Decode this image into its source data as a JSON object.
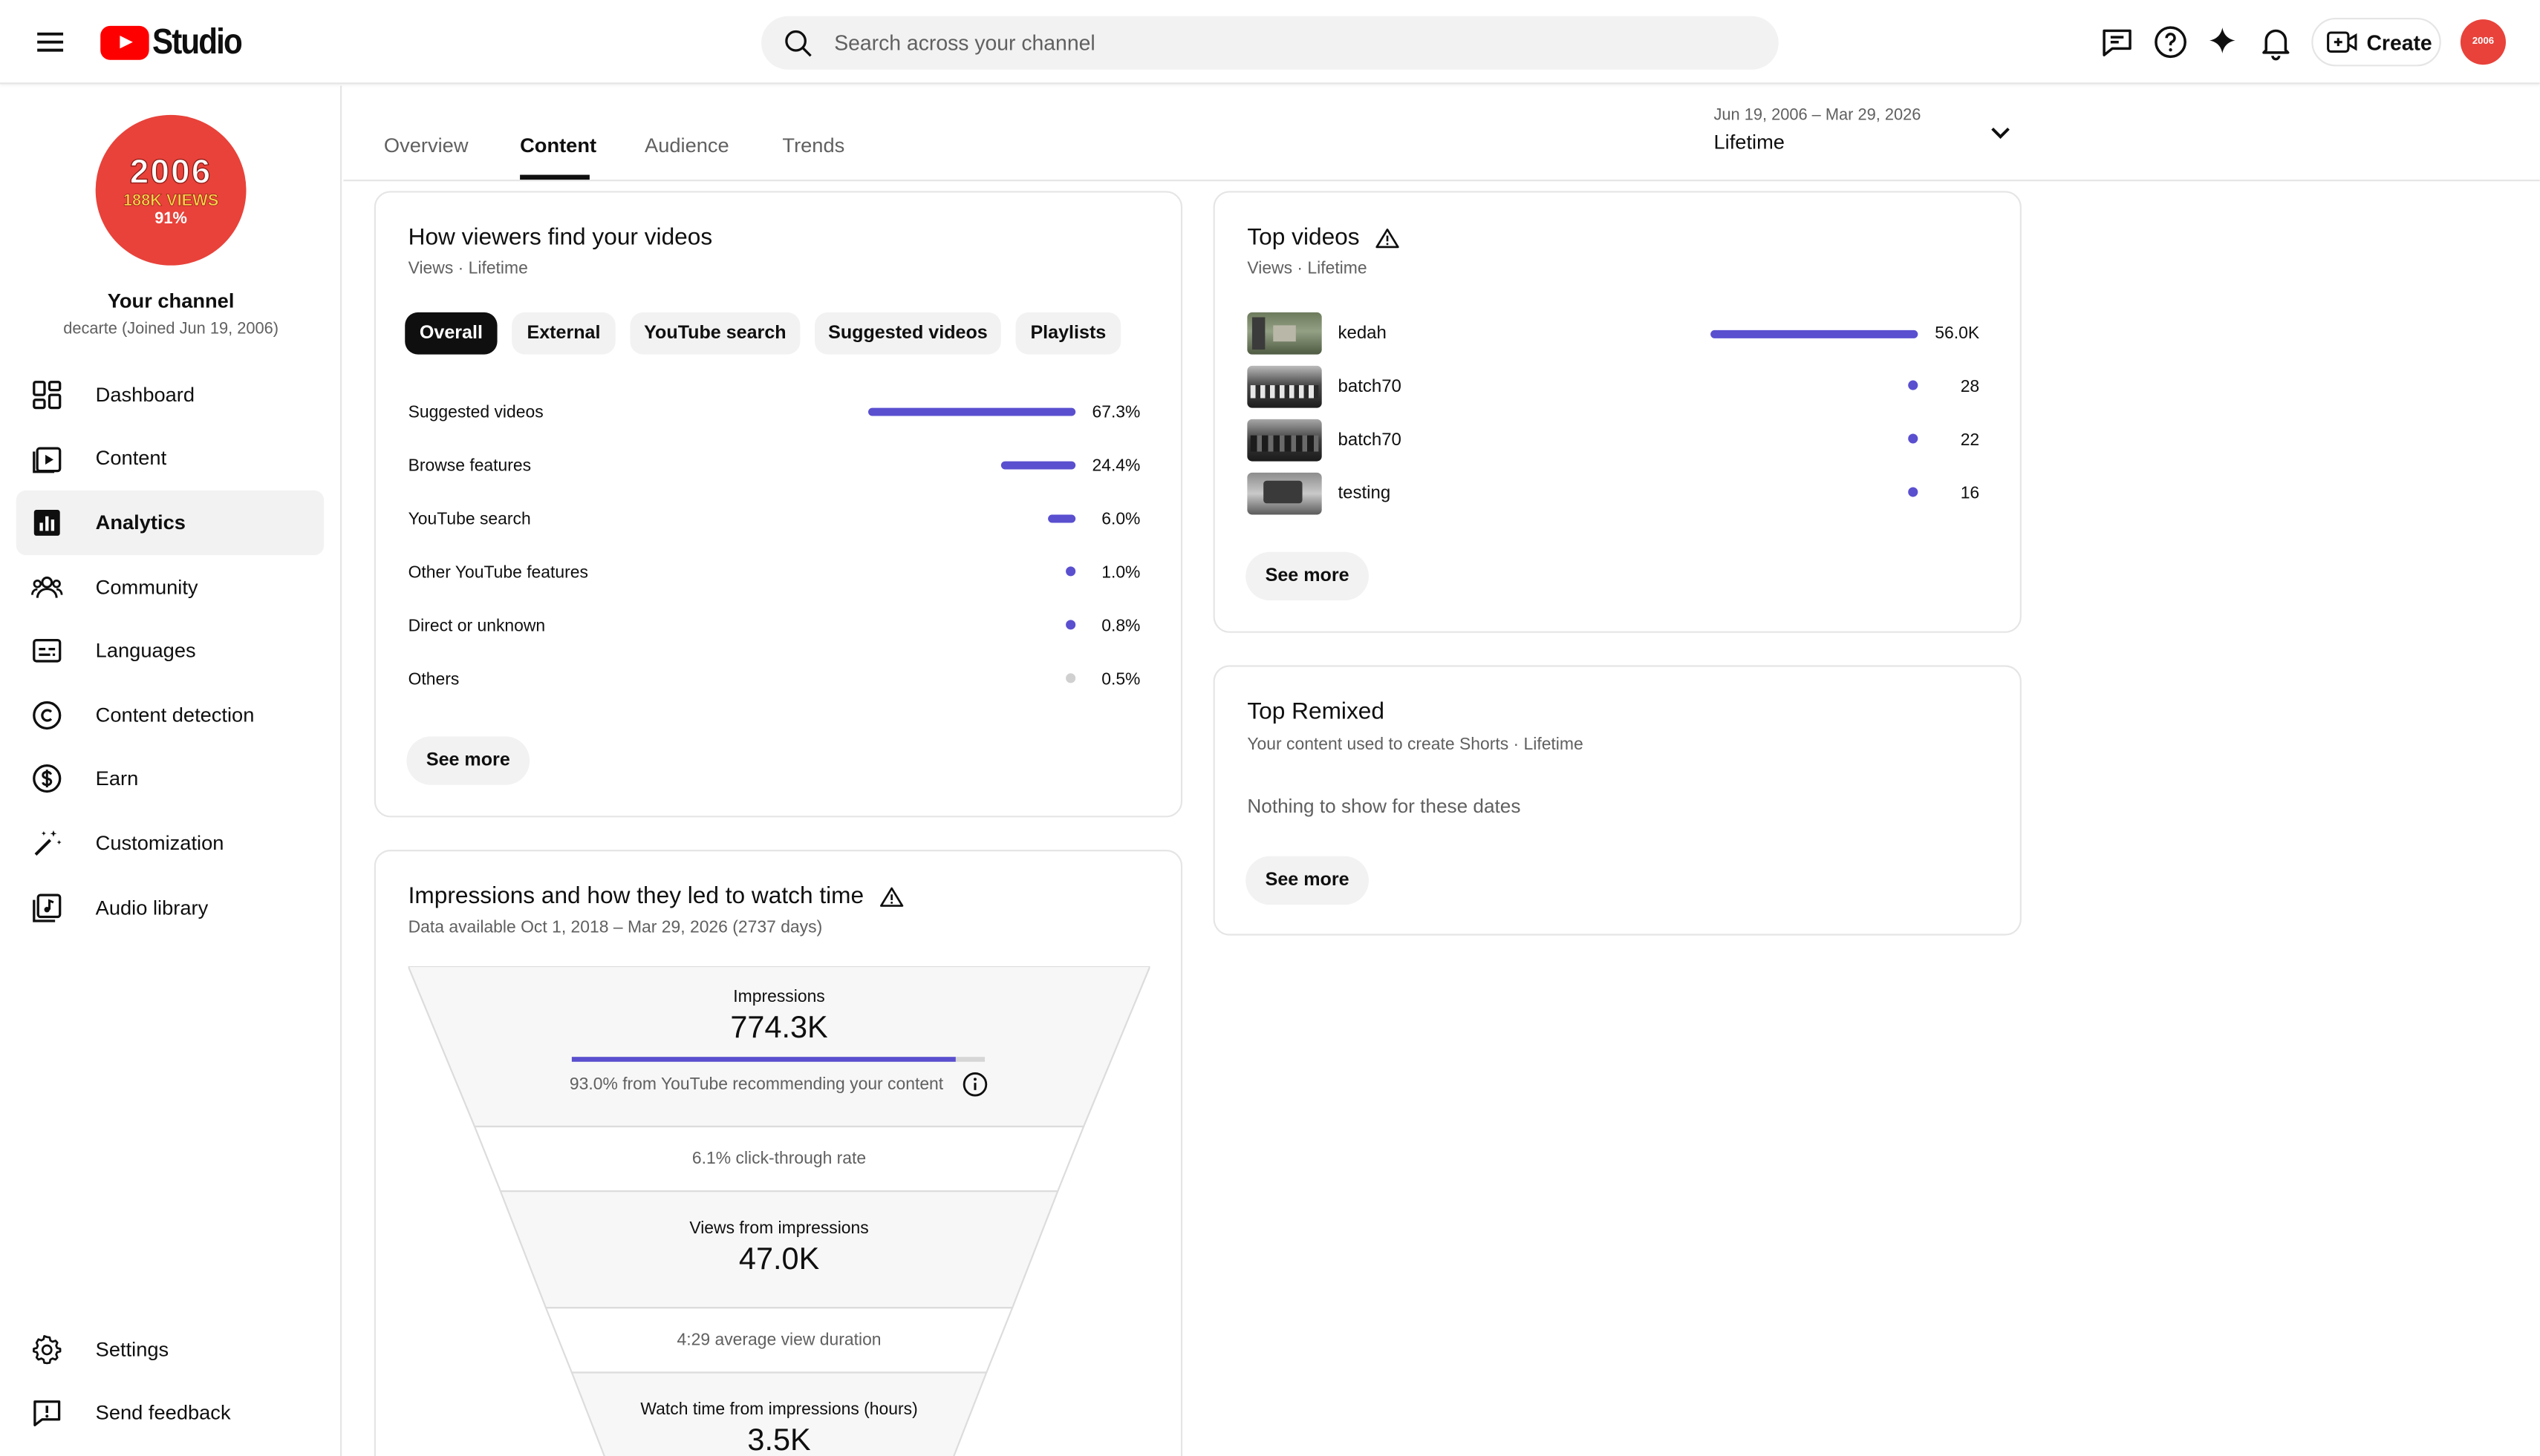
{
  "topbar": {
    "logo_text": "Studio",
    "search_placeholder": "Search across your channel",
    "create_label": "Create",
    "avatar_text": "2006"
  },
  "channel": {
    "avatar_year": "2006",
    "avatar_views": "188K VIEWS",
    "avatar_pct": "91%",
    "name": "Your channel",
    "handle": "decarte (Joined Jun 19, 2006)"
  },
  "nav": {
    "items": [
      {
        "label": "Dashboard",
        "icon": "dashboard-icon"
      },
      {
        "label": "Content",
        "icon": "content-icon"
      },
      {
        "label": "Analytics",
        "icon": "analytics-icon",
        "active": true
      },
      {
        "label": "Community",
        "icon": "community-icon"
      },
      {
        "label": "Languages",
        "icon": "languages-icon"
      },
      {
        "label": "Content detection",
        "icon": "copyright-icon"
      },
      {
        "label": "Earn",
        "icon": "dollar-icon"
      },
      {
        "label": "Customization",
        "icon": "magic-wand-icon"
      },
      {
        "label": "Audio library",
        "icon": "audio-library-icon"
      }
    ],
    "bottom": [
      {
        "label": "Settings",
        "icon": "gear-icon"
      },
      {
        "label": "Send feedback",
        "icon": "feedback-icon"
      }
    ]
  },
  "tabs": [
    "Overview",
    "Content",
    "Audience",
    "Trends"
  ],
  "active_tab": "Content",
  "date": {
    "range": "Jun 19, 2006 – Mar 29, 2026",
    "label": "Lifetime"
  },
  "traffic": {
    "title": "How viewers find your videos",
    "subtitle": "Views · Lifetime",
    "filters": [
      "Overall",
      "External",
      "YouTube search",
      "Suggested videos",
      "Playlists"
    ],
    "active_filter": "Overall",
    "rows": [
      {
        "label": "Suggested videos",
        "value": "67.3%",
        "pct": 67.3
      },
      {
        "label": "Browse features",
        "value": "24.4%",
        "pct": 24.4
      },
      {
        "label": "YouTube search",
        "value": "6.0%",
        "pct": 6.0
      },
      {
        "label": "Other YouTube features",
        "value": "1.0%",
        "pct": 1.0
      },
      {
        "label": "Direct or unknown",
        "value": "0.8%",
        "pct": 0.8
      },
      {
        "label": "Others",
        "value": "0.5%",
        "pct": 0.5
      }
    ],
    "see_more": "See more"
  },
  "funnel": {
    "title": "Impressions and how they led to watch time",
    "subtitle": "Data available Oct 1, 2018 – Mar 29, 2026 (2737 days)",
    "impressions_label": "Impressions",
    "impressions_value": "774.3K",
    "impressions_bar_pct": 93.0,
    "impressions_note": "93.0% from YouTube recommending your content",
    "ctr": "6.1% click-through rate",
    "views_label": "Views from impressions",
    "views_value": "47.0K",
    "avg_duration": "4:29 average view duration",
    "watch_label": "Watch time from impressions (hours)",
    "watch_value": "3.5K"
  },
  "top_videos": {
    "title": "Top videos",
    "subtitle": "Views · Lifetime",
    "rows": [
      {
        "name": "kedah",
        "value": "56.0K",
        "views": 56000
      },
      {
        "name": "batch70",
        "value": "28",
        "views": 28
      },
      {
        "name": "batch70",
        "value": "22",
        "views": 22
      },
      {
        "name": "testing",
        "value": "16",
        "views": 16
      }
    ],
    "see_more": "See more"
  },
  "top_remixed": {
    "title": "Top Remixed",
    "subtitle": "Your content used to create Shorts · Lifetime",
    "empty": "Nothing to show for these dates",
    "see_more": "See more"
  },
  "colors": {
    "accent": "#5a4fcf",
    "brand_red": "#ff0000",
    "avatar_red": "#e8423a",
    "muted_dot": "#d0d0d0"
  }
}
